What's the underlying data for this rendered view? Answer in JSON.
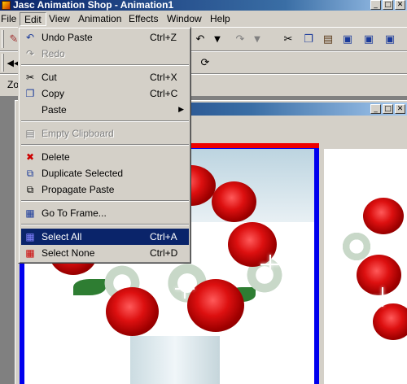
{
  "window": {
    "title": "Jasc Animation Shop - Animation1",
    "controls": [
      "_",
      "□",
      "✕"
    ]
  },
  "menubar": {
    "items": [
      "File",
      "Edit",
      "View",
      "Animation",
      "Effects",
      "Window",
      "Help"
    ],
    "active": "Edit"
  },
  "toolbar": {
    "zoom_label": "Zo"
  },
  "document": {
    "controls": [
      "_",
      "□",
      "✕"
    ]
  },
  "edit_menu": {
    "items": [
      {
        "label": "Undo Paste",
        "shortcut": "Ctrl+Z",
        "icon": "undo-icon",
        "enabled": true
      },
      {
        "label": "Redo",
        "shortcut": "",
        "icon": "redo-icon",
        "enabled": false
      },
      {
        "label": "Cut",
        "shortcut": "Ctrl+X",
        "icon": "scissors-icon",
        "enabled": true
      },
      {
        "label": "Copy",
        "shortcut": "Ctrl+C",
        "icon": "copy-icon",
        "enabled": true
      },
      {
        "label": "Paste",
        "shortcut": "",
        "icon": "",
        "enabled": true,
        "submenu": true
      },
      {
        "label": "Empty Clipboard",
        "shortcut": "",
        "icon": "clipboard-icon",
        "enabled": false
      },
      {
        "label": "Delete",
        "shortcut": "",
        "icon": "delete-icon",
        "enabled": true
      },
      {
        "label": "Duplicate Selected",
        "shortcut": "",
        "icon": "duplicate-icon",
        "enabled": true
      },
      {
        "label": "Propagate Paste",
        "shortcut": "",
        "icon": "propagate-icon",
        "enabled": true
      },
      {
        "label": "Go To Frame...",
        "shortcut": "",
        "icon": "film-icon",
        "enabled": true
      },
      {
        "label": "Select All",
        "shortcut": "Ctrl+A",
        "icon": "select-all-icon",
        "enabled": true,
        "highlighted": true
      },
      {
        "label": "Select None",
        "shortcut": "Ctrl+D",
        "icon": "select-none-icon",
        "enabled": true
      }
    ]
  },
  "colors": {
    "title_active": "#0a246a",
    "menu_highlight": "#0a246a",
    "face": "#d4d0c8",
    "frame_border_blue": "#0000ee",
    "frame_border_red": "#ee0000"
  }
}
